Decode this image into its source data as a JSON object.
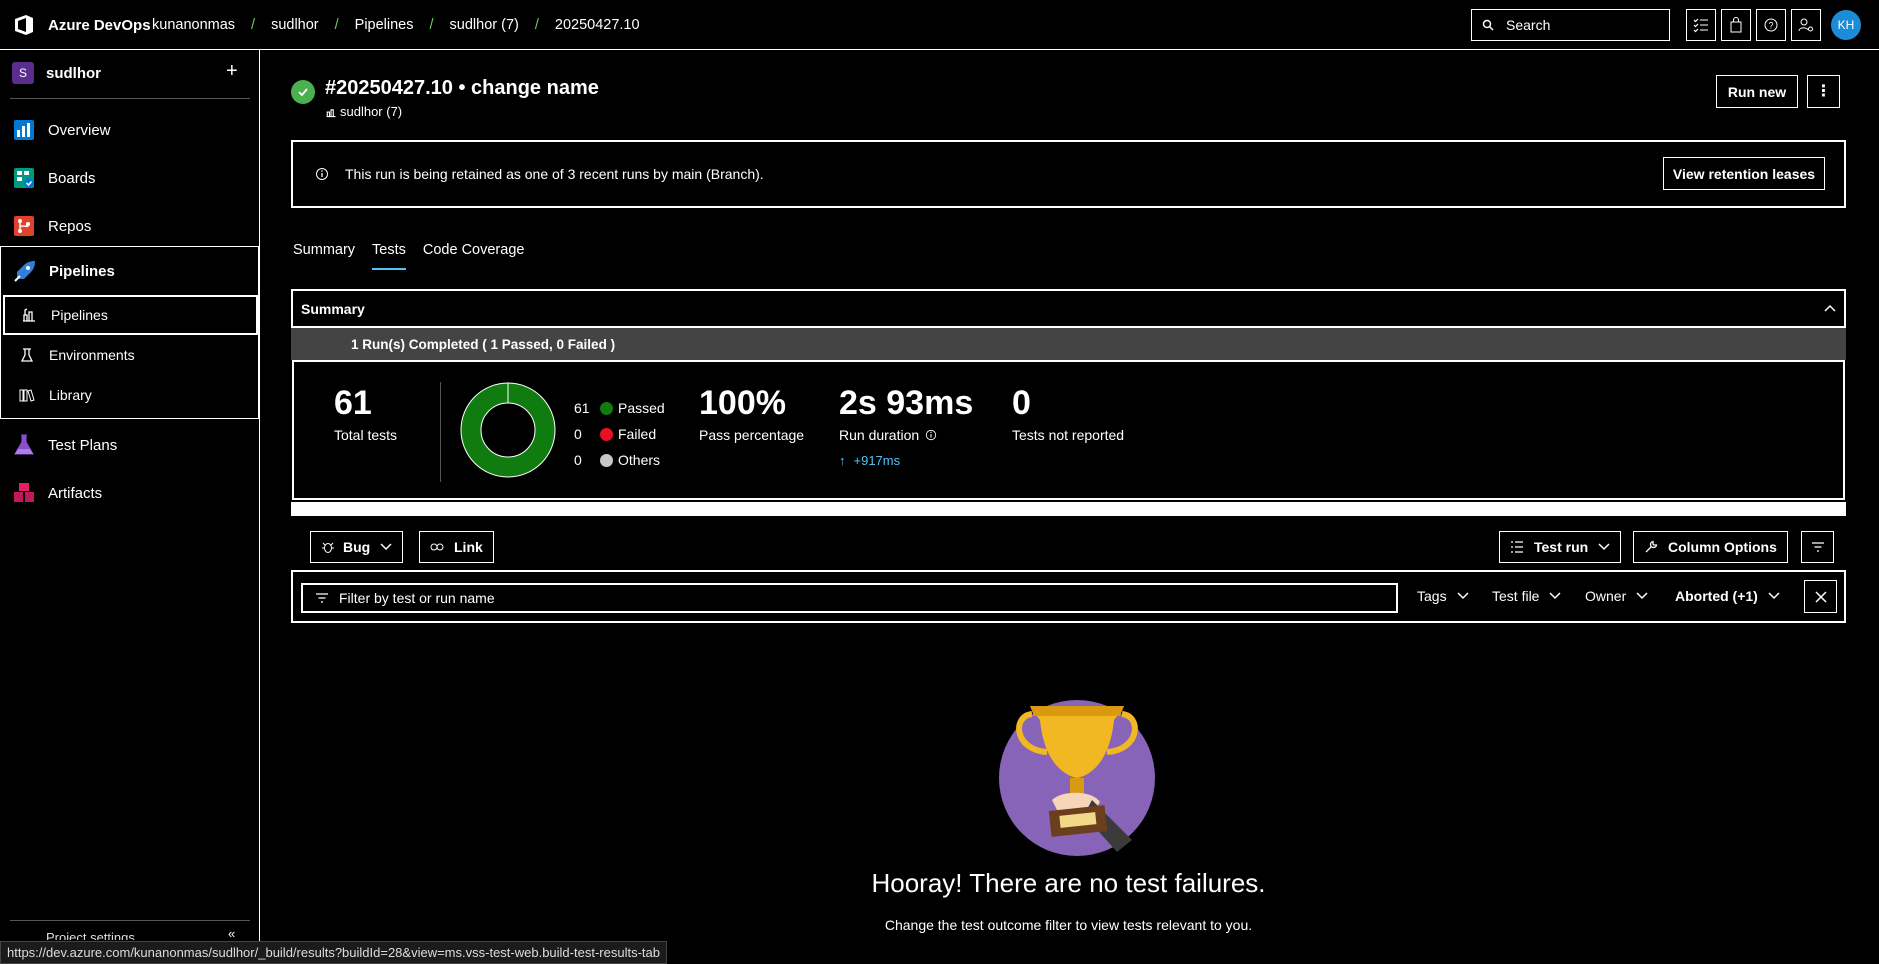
{
  "topbar": {
    "brand": "Azure DevOps",
    "breadcrumbs": [
      "kunanonmas",
      "sudlhor",
      "Pipelines",
      "sudlhor (7)",
      "20250427.10"
    ],
    "search_placeholder": "Search",
    "avatar_initials": "KH"
  },
  "sidebar": {
    "project_initial": "S",
    "project_name": "sudlhor",
    "items": [
      {
        "label": "Overview",
        "icon": "overview-icon"
      },
      {
        "label": "Boards",
        "icon": "boards-icon"
      },
      {
        "label": "Repos",
        "icon": "repos-icon"
      },
      {
        "label": "Pipelines",
        "icon": "pipelines-icon"
      },
      {
        "label": "Test Plans",
        "icon": "test-plans-icon"
      },
      {
        "label": "Artifacts",
        "icon": "artifacts-icon"
      }
    ],
    "pipelines_sub": [
      {
        "label": "Pipelines",
        "icon": "pipeline-list-icon"
      },
      {
        "label": "Environments",
        "icon": "environments-icon"
      },
      {
        "label": "Library",
        "icon": "library-icon"
      }
    ],
    "project_settings_label": "Project settings"
  },
  "run": {
    "title": "#20250427.10 • change name",
    "pipeline": "sudlhor (7)",
    "run_new_label": "Run new"
  },
  "banner": {
    "message": "This run is being retained as one of 3 recent runs by main (Branch).",
    "button": "View retention leases"
  },
  "tabs": [
    "Summary",
    "Tests",
    "Code Coverage"
  ],
  "summary": {
    "header": "Summary",
    "completed": "1 Run(s) Completed ( 1 Passed, 0 Failed )",
    "total_tests": "61",
    "total_tests_label": "Total tests",
    "legend": [
      {
        "count": "61",
        "label": "Passed",
        "color": "#107c10"
      },
      {
        "count": "0",
        "label": "Failed",
        "color": "#e81123"
      },
      {
        "count": "0",
        "label": "Others",
        "color": "#c8c8c8"
      }
    ],
    "pass_pct": "100%",
    "pass_pct_label": "Pass percentage",
    "run_duration": "2s 93ms",
    "run_duration_label": "Run duration",
    "duration_delta": "+917ms",
    "not_reported": "0",
    "not_reported_label": "Tests not reported"
  },
  "toolbar": {
    "bug": "Bug",
    "link": "Link",
    "test_run": "Test run",
    "column_options": "Column Options"
  },
  "filter": {
    "placeholder": "Filter by test or run name",
    "tags": "Tags",
    "test_file": "Test file",
    "owner": "Owner",
    "outcome": "Aborted (+1)"
  },
  "empty": {
    "title": "Hooray! There are no test failures.",
    "subtitle": "Change the test outcome filter to view tests relevant to you."
  },
  "statusbar": "https://dev.azure.com/kunanonmas/sudlhor/_build/results?buildId=28&view=ms.vss-test-web.build-test-results-tab"
}
